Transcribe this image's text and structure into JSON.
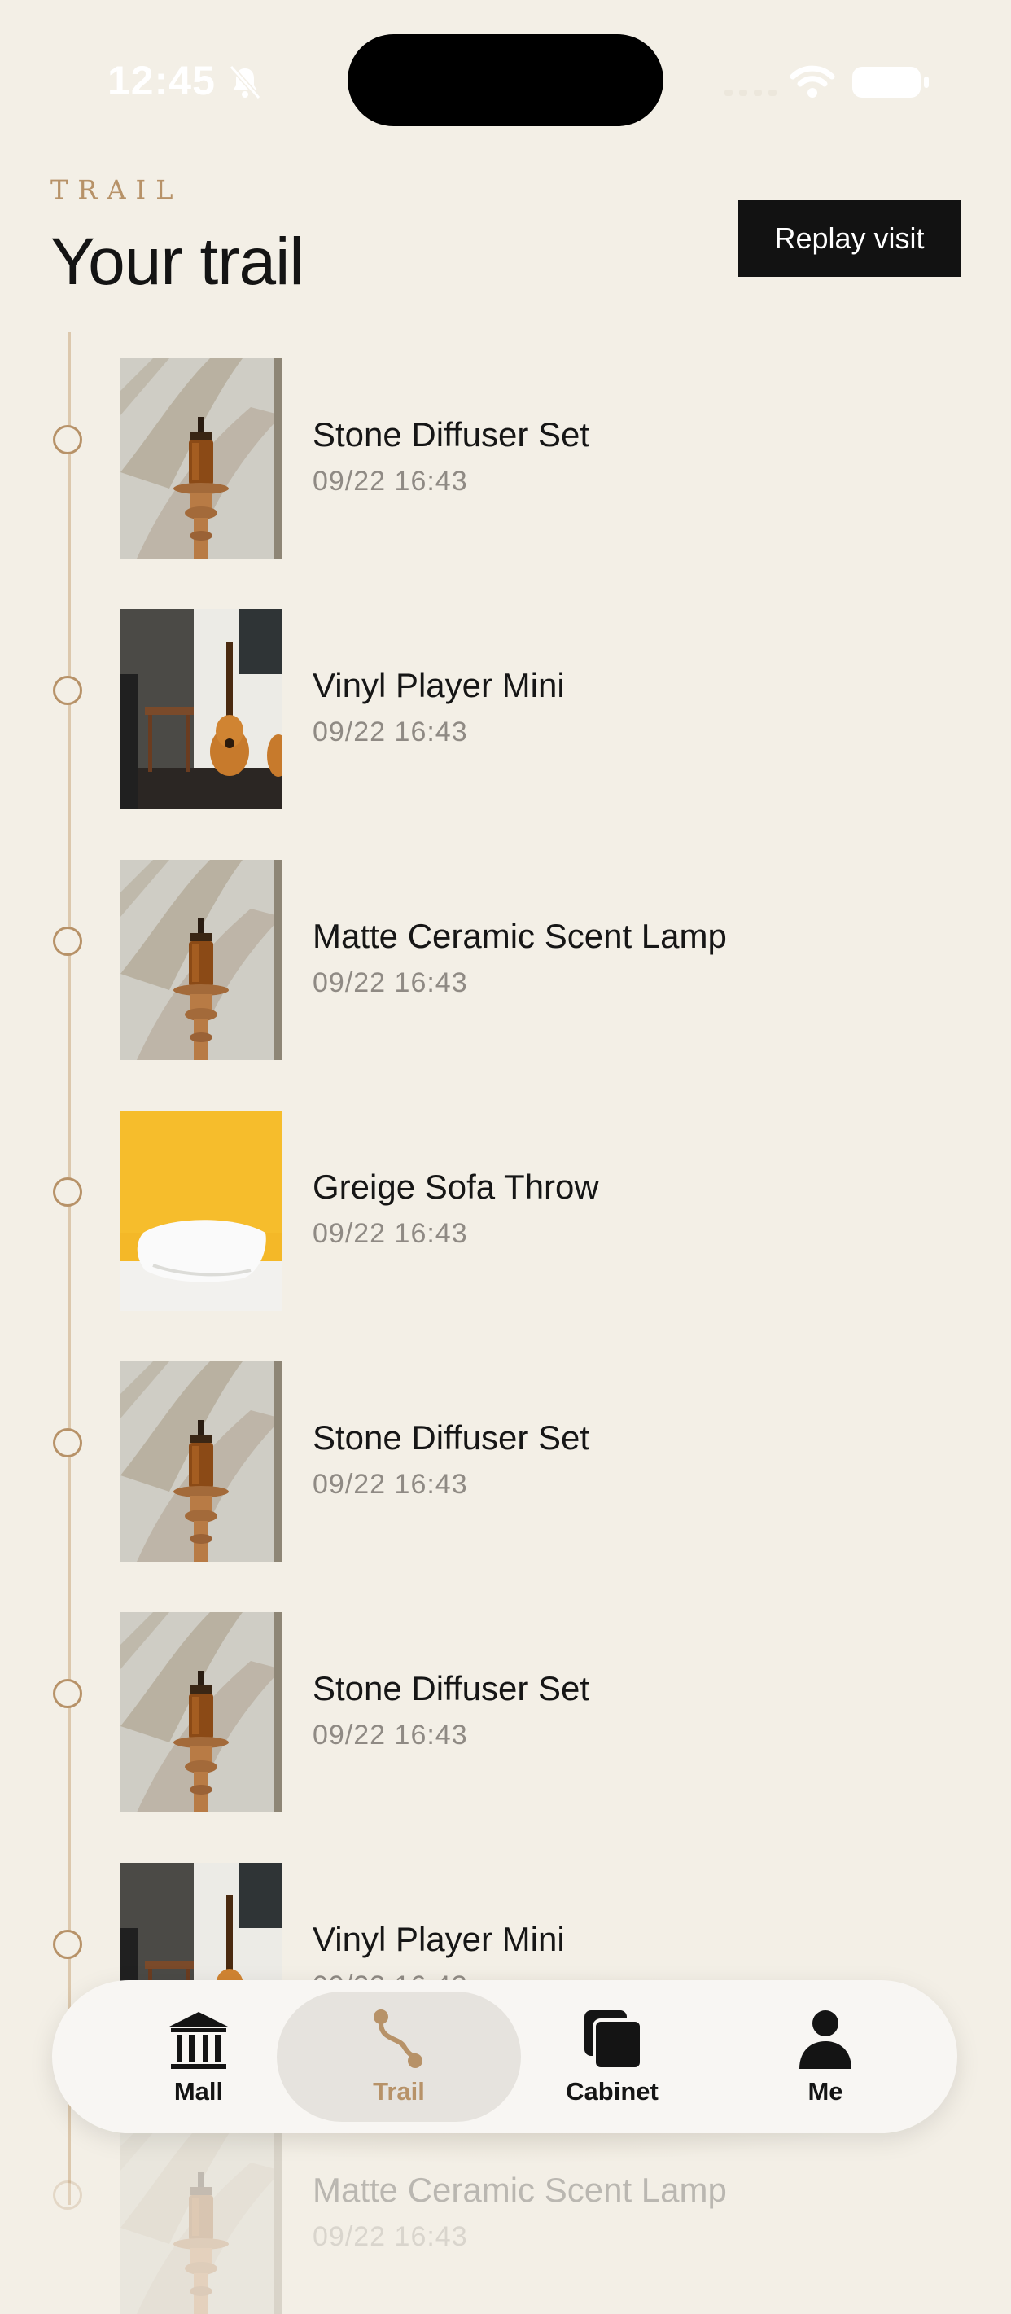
{
  "status": {
    "time": "12:45"
  },
  "header": {
    "eyebrow": "TRAIL",
    "title": "Your trail",
    "replay_label": "Replay visit"
  },
  "trail": [
    {
      "name": "Stone Diffuser Set",
      "time": "09/22 16:43",
      "image": "bottle"
    },
    {
      "name": "Vinyl Player Mini",
      "time": "09/22 16:43",
      "image": "room"
    },
    {
      "name": "Matte Ceramic Scent Lamp",
      "time": "09/22 16:43",
      "image": "bottle"
    },
    {
      "name": "Greige Sofa Throw",
      "time": "09/22 16:43",
      "image": "pillow"
    },
    {
      "name": "Stone Diffuser Set",
      "time": "09/22 16:43",
      "image": "bottle"
    },
    {
      "name": "Stone Diffuser Set",
      "time": "09/22 16:43",
      "image": "bottle"
    },
    {
      "name": "Vinyl Player Mini",
      "time": "09/22 16:43",
      "image": "room"
    },
    {
      "name": "Matte Ceramic Scent Lamp",
      "time": "09/22 16:43",
      "image": "bottle"
    }
  ],
  "tabs": [
    {
      "label": "Mall",
      "icon": "museum-icon",
      "active": false
    },
    {
      "label": "Trail",
      "icon": "route-icon",
      "active": true
    },
    {
      "label": "Cabinet",
      "icon": "stack-icon",
      "active": false
    },
    {
      "label": "Me",
      "icon": "person-icon",
      "active": false
    }
  ],
  "colors": {
    "background": "#f3efe6",
    "accent": "#b79268",
    "button": "#121212"
  }
}
